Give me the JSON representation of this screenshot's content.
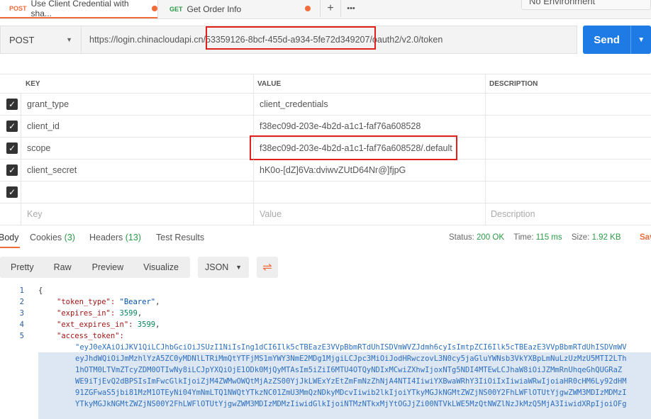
{
  "tabs": [
    {
      "method": "POST",
      "title": "Use Client Credential with sha...",
      "active": true
    },
    {
      "method": "GET",
      "title": "Get Order Info",
      "active": false
    }
  ],
  "tab_actions": {
    "add": "+",
    "more": "•••"
  },
  "environment": "No Environment",
  "request": {
    "method": "POST",
    "url_prefix": "https://login.chinacloudapi.cn/",
    "tenant_id": "53359126-8bcf-455d-a934-5fe72d349207",
    "url_suffix": "/oauth2/v2.0/token",
    "send_label": "Send"
  },
  "params": {
    "headers": {
      "key": "KEY",
      "value": "VALUE",
      "description": "DESCRIPTION"
    },
    "rows": [
      {
        "key": "grant_type",
        "value": "client_credentials",
        "checked": true
      },
      {
        "key": "client_id",
        "value": "f38ec09d-203e-4b2d-a1c1-faf76a608528",
        "checked": true
      },
      {
        "key": "scope",
        "value": "f38ec09d-203e-4b2d-a1c1-faf76a608528/.default",
        "checked": true
      },
      {
        "key": "client_secret",
        "value": "hK0o-[dZ]6Va:dviwvZUtD64Nr@]fjpG",
        "checked": true
      },
      {
        "key": "",
        "value": "",
        "checked": true
      }
    ],
    "placeholder": {
      "key": "Key",
      "value": "Value",
      "description": "Description"
    }
  },
  "response": {
    "tabs": {
      "body": "Body",
      "cookies": "Cookies",
      "cookies_count": "(3)",
      "headers": "Headers",
      "headers_count": "(13)",
      "test_results": "Test Results"
    },
    "status_label": "Status:",
    "status": "200 OK",
    "time_label": "Time:",
    "time": "115 ms",
    "size_label": "Size:",
    "size": "1.92 KB",
    "save": "Sav",
    "formats": [
      "Pretty",
      "Raw",
      "Preview",
      "Visualize"
    ],
    "format_select": "JSON",
    "lines": [
      "1",
      "2",
      "3",
      "4",
      "5"
    ],
    "json": {
      "open": "{",
      "token_type_key": "\"token_type\":",
      "token_type_val": "\"Bearer\"",
      "expires_in_key": "\"expires_in\":",
      "expires_in_val": "3599",
      "ext_expires_in_key": "\"ext_expires_in\":",
      "ext_expires_in_val": "3599",
      "access_token_key": "\"access_token\":",
      "access_token_lines": [
        "\"eyJ0eXAiOiJKV1QiLCJhbGciOiJSUzI1NiIsIng1dCI6Ilk5cTBEazE3VVpBbmRTdUhISDVmWVZJdmh6cyIsImtpZCI6Ilk5cTBEazE3VVpBbmRTdUhISDVmWV",
        "eyJhdWQiOiJmMzhlYzA5ZC0yMDNlLTRiMmQtYTFjMS1mYWY3NmE2MDg1MjgiLCJpc3MiOiJodHRwczovL3N0cy5jaGluYWNsb3VkYXBpLmNuLzUzMzU5MTI2LTh",
        "1hOTM0LTVmZTcyZDM0OTIwNy8iLCJpYXQiOjE1ODk0MjQyMTAsIm5iZiI6MTU4OTQyNDIxMCwiZXhwIjoxNTg5NDI4MTEwLCJhaW8iOiJZMmRnUhqeGhQUGRaZ",
        "WE9iTjEvQ2dBPSIsImFwcGlkIjoiZjM4ZWMwOWQtMjAzZS00YjJkLWExYzEtZmFmNzZhNjA4NTI4IiwiYXBwaWRhY3IiOiIxIiwiaWRwIjoiaHR0cHM6Ly92dHM",
        "91ZGFwaS5jbi81MzM1OTEyNi04YmNmLTQ1NWQtYTkzNC01ZmU3MmQzNDkyMDcvIiwib2lkIjoiYTkyMGJkNGMtZWZjNS00Y2FhLWFlOTUtYjgwZWM3MDIzMDMzI",
        "YTkyMGJkNGMtZWZjNS00Y2FhLWFlOTUtYjgwZWM3MDIzMDMzIiwidGlkIjoiNTMzNTkxMjYtOGJjZi00NTVkLWE5MzQtNWZlNzJkMzQ5MjA3IiwidXRpIjoiOFg"
      ]
    }
  }
}
